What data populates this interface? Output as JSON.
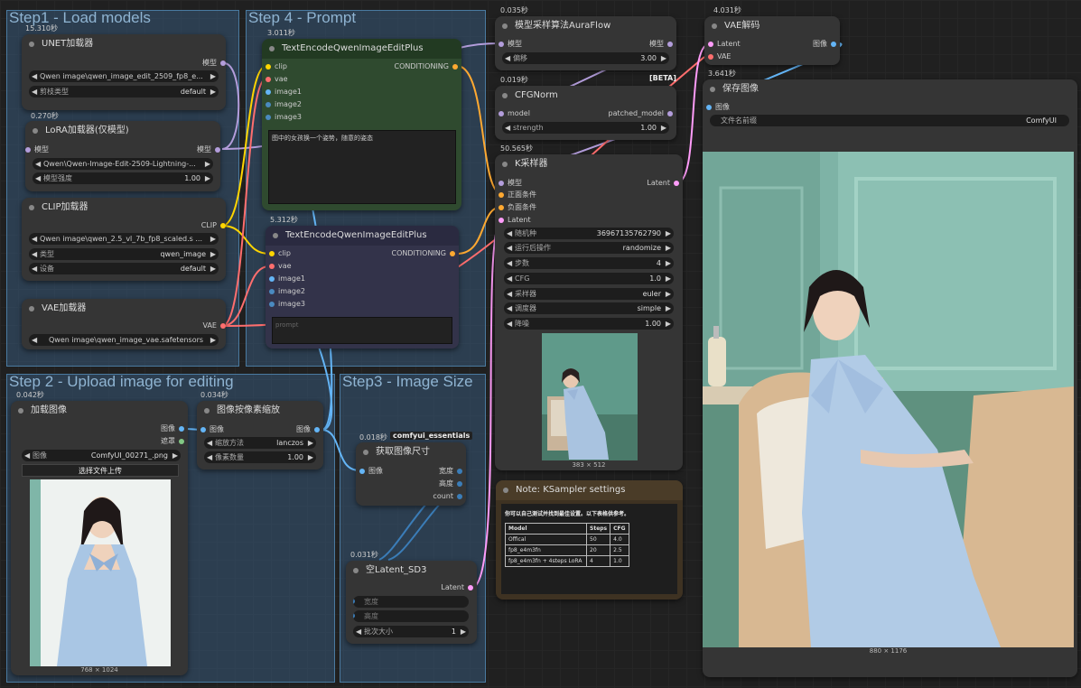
{
  "groups": {
    "step1": "Step1 - Load models",
    "step4": "Step 4 - Prompt",
    "step2": "Step 2 - Upload image for editing",
    "step3": "Step3 - Image Size"
  },
  "unet": {
    "timing": "15.310秒",
    "title": "UNET加载器",
    "out": "模型",
    "w1": "Qwen image\\qwen_image_edit_2509_fp8_e...",
    "w2_label": "剪枝类型",
    "w2_value": "default"
  },
  "lora": {
    "timing": "0.270秒",
    "title": "LoRA加载器(仅模型)",
    "in": "模型",
    "out": "模型",
    "w1": "Qwen\\Qwen-Image-Edit-2509-Lightning-...",
    "w2_label": "模型强度",
    "w2_value": "1.00"
  },
  "clip": {
    "title": "CLIP加载器",
    "out": "CLIP",
    "w1": "Qwen image\\qwen_2.5_vl_7b_fp8_scaled.s ...",
    "w2_label": "类型",
    "w2_value": "qwen_image",
    "w3_label": "设备",
    "w3_value": "default"
  },
  "vae_loader": {
    "title": "VAE加载器",
    "out": "VAE",
    "w1": "Qwen image\\qwen_image_vae.safetensors"
  },
  "te1": {
    "timing": "3.011秒",
    "title": "TextEncodeQwenImageEditPlus",
    "in": [
      "clip",
      "vae",
      "image1",
      "image2",
      "image3"
    ],
    "out": "CONDITIONING",
    "prompt": "图中的女孩换一个姿势，随意的姿态"
  },
  "te2": {
    "timing": "5.312秒",
    "title": "TextEncodeQwenImageEditPlus",
    "in": [
      "clip",
      "vae",
      "image1",
      "image2",
      "image3"
    ],
    "out": "CONDITIONING",
    "placeholder": "prompt"
  },
  "aura": {
    "timing": "0.035秒",
    "title": "模型采样算法AuraFlow",
    "in": "模型",
    "out": "模型",
    "w_label": "偏移",
    "w_value": "3.00"
  },
  "cfgnorm": {
    "timing": "0.019秒",
    "beta": "[BETA]",
    "title": "CFGNorm",
    "in": "model",
    "out": "patched_model",
    "w_label": "strength",
    "w_value": "1.00"
  },
  "ksampler": {
    "timing": "50.565秒",
    "title": "K采样器",
    "in": [
      "模型",
      "正面条件",
      "负面条件",
      "Latent"
    ],
    "out": "Latent",
    "widgets": [
      {
        "l": "随机种",
        "v": "36967135762790"
      },
      {
        "l": "运行后操作",
        "v": "randomize"
      },
      {
        "l": "步数",
        "v": "4"
      },
      {
        "l": "CFG",
        "v": "1.0"
      },
      {
        "l": "采样器",
        "v": "euler"
      },
      {
        "l": "调度器",
        "v": "simple"
      },
      {
        "l": "降噪",
        "v": "1.00"
      }
    ],
    "caption": "383 × 512"
  },
  "vae_decode": {
    "timing": "4.031秒",
    "title": "VAE解码",
    "in": [
      "Latent",
      "VAE"
    ],
    "out": "图像"
  },
  "save": {
    "timing": "3.641秒",
    "title": "保存图像",
    "in": "图像",
    "w_label": "文件名前缀",
    "w_value": "ComfyUI",
    "caption": "880 × 1176"
  },
  "load_image": {
    "timing": "0.042秒",
    "title": "加载图像",
    "out": [
      "图像",
      "遮罩"
    ],
    "w_label": "图像",
    "w_value": "ComfyUI_00271_.png",
    "button": "选择文件上传",
    "caption": "768 × 1024"
  },
  "scale": {
    "timing": "0.034秒",
    "title": "图像按像素缩放",
    "in": "图像",
    "out": "图像",
    "w1_label": "缩放方法",
    "w1_value": "lanczos",
    "w2_label": "像素数量",
    "w2_value": "1.00"
  },
  "getsize": {
    "timing": "0.018秒",
    "badge": "comfyui_essentials",
    "title": "获取图像尺寸",
    "in": "图像",
    "out": [
      "宽度",
      "高度",
      "count"
    ]
  },
  "latent": {
    "timing": "0.031秒",
    "title": "空Latent_SD3",
    "out": "Latent",
    "w1": "宽度",
    "w2": "高度",
    "w3_label": "批次大小",
    "w3_value": "1"
  },
  "note": {
    "title": "Note: KSampler settings",
    "text": "你可以自己测试并找到最佳设置。以下表格供参考。",
    "headers": [
      "Model",
      "Steps",
      "CFG"
    ],
    "rows": [
      [
        "Offical",
        "50",
        "4.0"
      ],
      [
        "fp8_e4m3fn",
        "20",
        "2.5"
      ],
      [
        "fp8_e4m3fn + 4steps LoRA",
        "4",
        "1.0"
      ]
    ]
  },
  "colors": {
    "model": "#b39ddb",
    "clip": "#ffd500",
    "vae": "#ff6e6e",
    "image": "#64b5f6",
    "cond": "#ffa931",
    "latent": "#ff9cf9",
    "node": "#353535",
    "group": "#3f6f97"
  }
}
